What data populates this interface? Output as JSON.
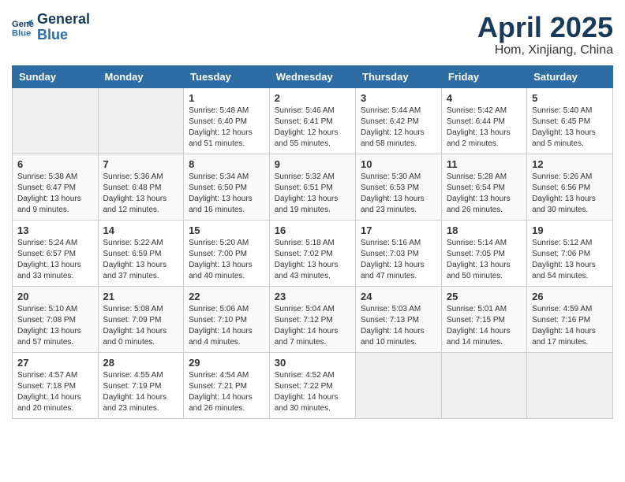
{
  "logo": {
    "line1": "General",
    "line2": "Blue"
  },
  "title": "April 2025",
  "location": "Hom, Xinjiang, China",
  "weekdays": [
    "Sunday",
    "Monday",
    "Tuesday",
    "Wednesday",
    "Thursday",
    "Friday",
    "Saturday"
  ],
  "weeks": [
    [
      {
        "day": "",
        "content": ""
      },
      {
        "day": "",
        "content": ""
      },
      {
        "day": "1",
        "content": "Sunrise: 5:48 AM\nSunset: 6:40 PM\nDaylight: 12 hours\nand 51 minutes."
      },
      {
        "day": "2",
        "content": "Sunrise: 5:46 AM\nSunset: 6:41 PM\nDaylight: 12 hours\nand 55 minutes."
      },
      {
        "day": "3",
        "content": "Sunrise: 5:44 AM\nSunset: 6:42 PM\nDaylight: 12 hours\nand 58 minutes."
      },
      {
        "day": "4",
        "content": "Sunrise: 5:42 AM\nSunset: 6:44 PM\nDaylight: 13 hours\nand 2 minutes."
      },
      {
        "day": "5",
        "content": "Sunrise: 5:40 AM\nSunset: 6:45 PM\nDaylight: 13 hours\nand 5 minutes."
      }
    ],
    [
      {
        "day": "6",
        "content": "Sunrise: 5:38 AM\nSunset: 6:47 PM\nDaylight: 13 hours\nand 9 minutes."
      },
      {
        "day": "7",
        "content": "Sunrise: 5:36 AM\nSunset: 6:48 PM\nDaylight: 13 hours\nand 12 minutes."
      },
      {
        "day": "8",
        "content": "Sunrise: 5:34 AM\nSunset: 6:50 PM\nDaylight: 13 hours\nand 16 minutes."
      },
      {
        "day": "9",
        "content": "Sunrise: 5:32 AM\nSunset: 6:51 PM\nDaylight: 13 hours\nand 19 minutes."
      },
      {
        "day": "10",
        "content": "Sunrise: 5:30 AM\nSunset: 6:53 PM\nDaylight: 13 hours\nand 23 minutes."
      },
      {
        "day": "11",
        "content": "Sunrise: 5:28 AM\nSunset: 6:54 PM\nDaylight: 13 hours\nand 26 minutes."
      },
      {
        "day": "12",
        "content": "Sunrise: 5:26 AM\nSunset: 6:56 PM\nDaylight: 13 hours\nand 30 minutes."
      }
    ],
    [
      {
        "day": "13",
        "content": "Sunrise: 5:24 AM\nSunset: 6:57 PM\nDaylight: 13 hours\nand 33 minutes."
      },
      {
        "day": "14",
        "content": "Sunrise: 5:22 AM\nSunset: 6:59 PM\nDaylight: 13 hours\nand 37 minutes."
      },
      {
        "day": "15",
        "content": "Sunrise: 5:20 AM\nSunset: 7:00 PM\nDaylight: 13 hours\nand 40 minutes."
      },
      {
        "day": "16",
        "content": "Sunrise: 5:18 AM\nSunset: 7:02 PM\nDaylight: 13 hours\nand 43 minutes."
      },
      {
        "day": "17",
        "content": "Sunrise: 5:16 AM\nSunset: 7:03 PM\nDaylight: 13 hours\nand 47 minutes."
      },
      {
        "day": "18",
        "content": "Sunrise: 5:14 AM\nSunset: 7:05 PM\nDaylight: 13 hours\nand 50 minutes."
      },
      {
        "day": "19",
        "content": "Sunrise: 5:12 AM\nSunset: 7:06 PM\nDaylight: 13 hours\nand 54 minutes."
      }
    ],
    [
      {
        "day": "20",
        "content": "Sunrise: 5:10 AM\nSunset: 7:08 PM\nDaylight: 13 hours\nand 57 minutes."
      },
      {
        "day": "21",
        "content": "Sunrise: 5:08 AM\nSunset: 7:09 PM\nDaylight: 14 hours\nand 0 minutes."
      },
      {
        "day": "22",
        "content": "Sunrise: 5:06 AM\nSunset: 7:10 PM\nDaylight: 14 hours\nand 4 minutes."
      },
      {
        "day": "23",
        "content": "Sunrise: 5:04 AM\nSunset: 7:12 PM\nDaylight: 14 hours\nand 7 minutes."
      },
      {
        "day": "24",
        "content": "Sunrise: 5:03 AM\nSunset: 7:13 PM\nDaylight: 14 hours\nand 10 minutes."
      },
      {
        "day": "25",
        "content": "Sunrise: 5:01 AM\nSunset: 7:15 PM\nDaylight: 14 hours\nand 14 minutes."
      },
      {
        "day": "26",
        "content": "Sunrise: 4:59 AM\nSunset: 7:16 PM\nDaylight: 14 hours\nand 17 minutes."
      }
    ],
    [
      {
        "day": "27",
        "content": "Sunrise: 4:57 AM\nSunset: 7:18 PM\nDaylight: 14 hours\nand 20 minutes."
      },
      {
        "day": "28",
        "content": "Sunrise: 4:55 AM\nSunset: 7:19 PM\nDaylight: 14 hours\nand 23 minutes."
      },
      {
        "day": "29",
        "content": "Sunrise: 4:54 AM\nSunset: 7:21 PM\nDaylight: 14 hours\nand 26 minutes."
      },
      {
        "day": "30",
        "content": "Sunrise: 4:52 AM\nSunset: 7:22 PM\nDaylight: 14 hours\nand 30 minutes."
      },
      {
        "day": "",
        "content": ""
      },
      {
        "day": "",
        "content": ""
      },
      {
        "day": "",
        "content": ""
      }
    ]
  ]
}
